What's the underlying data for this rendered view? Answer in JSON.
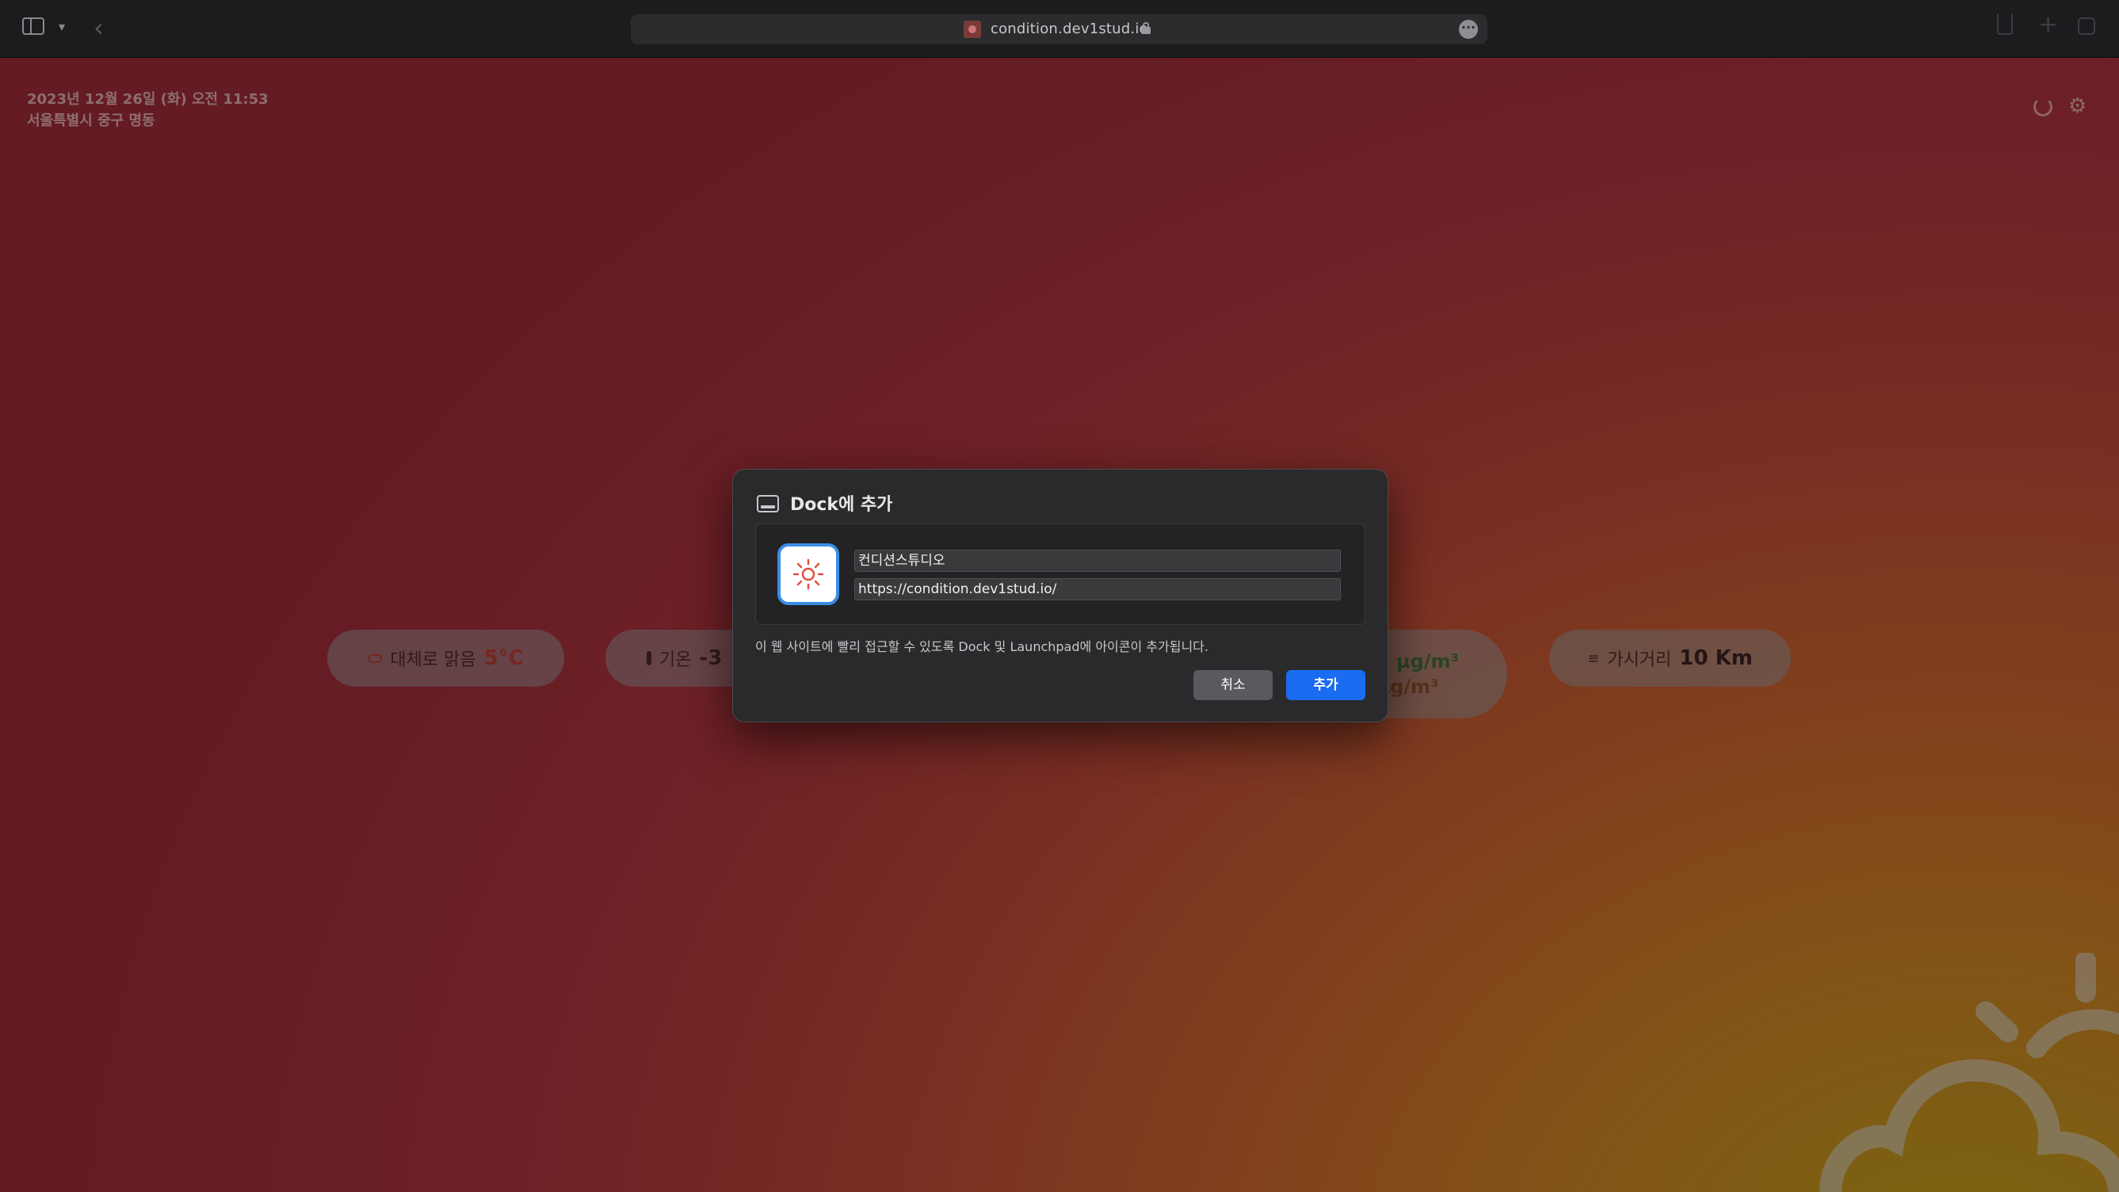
{
  "browser": {
    "url": "condition.dev1stud.io"
  },
  "page": {
    "datetime": "2023년 12월 26일 (화) 오전 11:53",
    "location": "서울특별시 중구 명동",
    "weather_pill": {
      "label": "대체로 맑음",
      "value": "5°C"
    },
    "temp_pill": {
      "label": "기온",
      "value": "-3"
    },
    "dust_pill": {
      "value": "1.1 µg/m³",
      "value2": "µg/m³"
    },
    "visibility_pill": {
      "label": "가시거리",
      "value": "10 Km"
    }
  },
  "dialog": {
    "title": "Dock에 추가",
    "app_name": "컨디션스튜디오",
    "app_url": "https://condition.dev1stud.io/",
    "description": "이 웹 사이트에 빨리 접근할 수 있도록 Dock 및 Launchpad에 아이콘이 추가됩니다.",
    "cancel_label": "취소",
    "add_label": "추가"
  },
  "colors": {
    "accent": "#1a6cf0",
    "page_red": "#a8323a",
    "page_yellow": "#b89e1a"
  }
}
